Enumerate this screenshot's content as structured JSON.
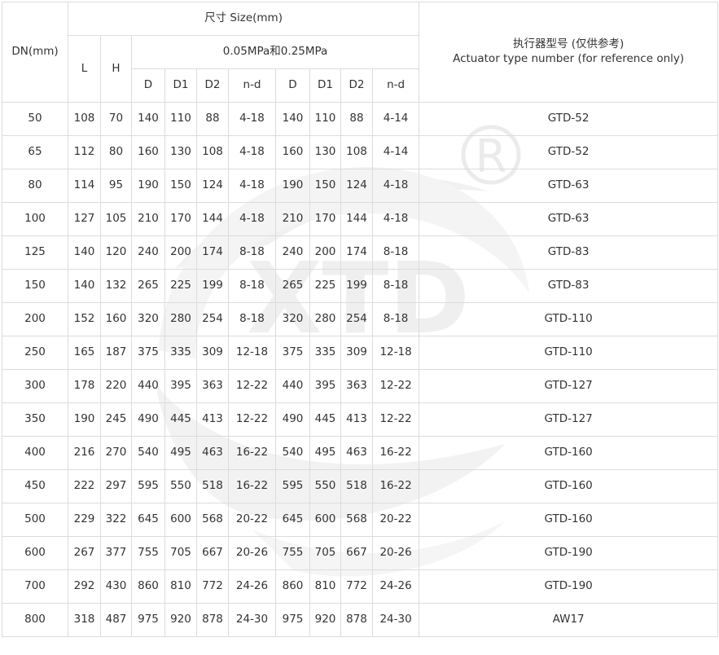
{
  "headers": {
    "dn": "DN(mm)",
    "size": "尺寸 Size(mm)",
    "l": "L",
    "h": "H",
    "pressure": "0.05MPa和0.25MPa",
    "sub": [
      "D",
      "D1",
      "D2",
      "n-d",
      "D",
      "D1",
      "D2",
      "n-d"
    ],
    "actuator_cn": "执行器型号 (仅供参考)",
    "actuator_en": "Actuator type number (for reference only)"
  },
  "rows": [
    [
      "50",
      "108",
      "70",
      "140",
      "110",
      "88",
      "4-18",
      "140",
      "110",
      "88",
      "4-14",
      "GTD-52"
    ],
    [
      "65",
      "112",
      "80",
      "160",
      "130",
      "108",
      "4-18",
      "160",
      "130",
      "108",
      "4-14",
      "GTD-52"
    ],
    [
      "80",
      "114",
      "95",
      "190",
      "150",
      "124",
      "4-18",
      "190",
      "150",
      "124",
      "4-18",
      "GTD-63"
    ],
    [
      "100",
      "127",
      "105",
      "210",
      "170",
      "144",
      "4-18",
      "210",
      "170",
      "144",
      "4-18",
      "GTD-63"
    ],
    [
      "125",
      "140",
      "120",
      "240",
      "200",
      "174",
      "8-18",
      "240",
      "200",
      "174",
      "8-18",
      "GTD-83"
    ],
    [
      "150",
      "140",
      "132",
      "265",
      "225",
      "199",
      "8-18",
      "265",
      "225",
      "199",
      "8-18",
      "GTD-83"
    ],
    [
      "200",
      "152",
      "160",
      "320",
      "280",
      "254",
      "8-18",
      "320",
      "280",
      "254",
      "8-18",
      "GTD-110"
    ],
    [
      "250",
      "165",
      "187",
      "375",
      "335",
      "309",
      "12-18",
      "375",
      "335",
      "309",
      "12-18",
      "GTD-110"
    ],
    [
      "300",
      "178",
      "220",
      "440",
      "395",
      "363",
      "12-22",
      "440",
      "395",
      "363",
      "12-22",
      "GTD-127"
    ],
    [
      "350",
      "190",
      "245",
      "490",
      "445",
      "413",
      "12-22",
      "490",
      "445",
      "413",
      "12-22",
      "GTD-127"
    ],
    [
      "400",
      "216",
      "270",
      "540",
      "495",
      "463",
      "16-22",
      "540",
      "495",
      "463",
      "16-22",
      "GTD-160"
    ],
    [
      "450",
      "222",
      "297",
      "595",
      "550",
      "518",
      "16-22",
      "595",
      "550",
      "518",
      "16-22",
      "GTD-160"
    ],
    [
      "500",
      "229",
      "322",
      "645",
      "600",
      "568",
      "20-22",
      "645",
      "600",
      "568",
      "20-22",
      "GTD-160"
    ],
    [
      "600",
      "267",
      "377",
      "755",
      "705",
      "667",
      "20-26",
      "755",
      "705",
      "667",
      "20-26",
      "GTD-190"
    ],
    [
      "700",
      "292",
      "430",
      "860",
      "810",
      "772",
      "24-26",
      "860",
      "810",
      "772",
      "24-26",
      "GTD-190"
    ],
    [
      "800",
      "318",
      "487",
      "975",
      "920",
      "878",
      "24-30",
      "975",
      "920",
      "878",
      "24-30",
      "AW17"
    ]
  ],
  "watermark": {
    "text": "XTD",
    "registered_mark": "R",
    "color": "#e8e8e8"
  }
}
